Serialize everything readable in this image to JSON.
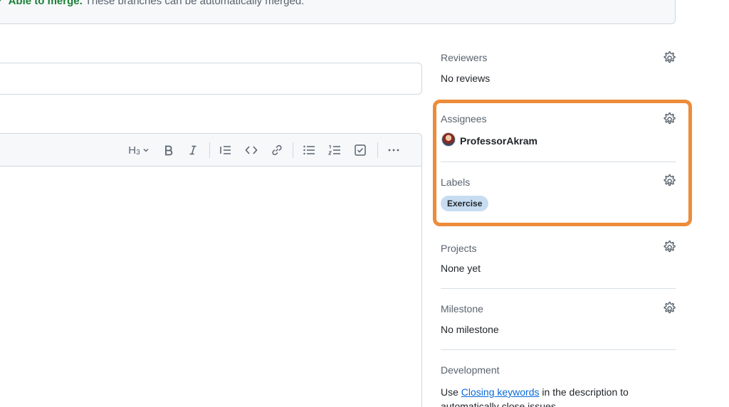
{
  "merge": {
    "status": "Able to merge.",
    "message": "These branches can be automatically merged."
  },
  "toolbar": {
    "heading_label": "H",
    "heading_sub": "3"
  },
  "sidebar": {
    "reviewers": {
      "label": "Reviewers",
      "value": "No reviews"
    },
    "assignees": {
      "label": "Assignees",
      "user": "ProfessorAkram"
    },
    "labels": {
      "label": "Labels",
      "tag": "Exercise"
    },
    "projects": {
      "label": "Projects",
      "value": "None yet"
    },
    "milestone": {
      "label": "Milestone",
      "value": "No milestone"
    },
    "development": {
      "label": "Development",
      "text_before": "Use ",
      "link": "Closing keywords",
      "text_after": " in the description to automatically close issues"
    }
  },
  "colors": {
    "highlight": "#ec8c3a",
    "success": "#1a7f37",
    "link": "#0969da",
    "label_bg": "#c7dcf0"
  },
  "icons": {
    "merge_status": "check-icon",
    "settings": "gear-icon"
  }
}
